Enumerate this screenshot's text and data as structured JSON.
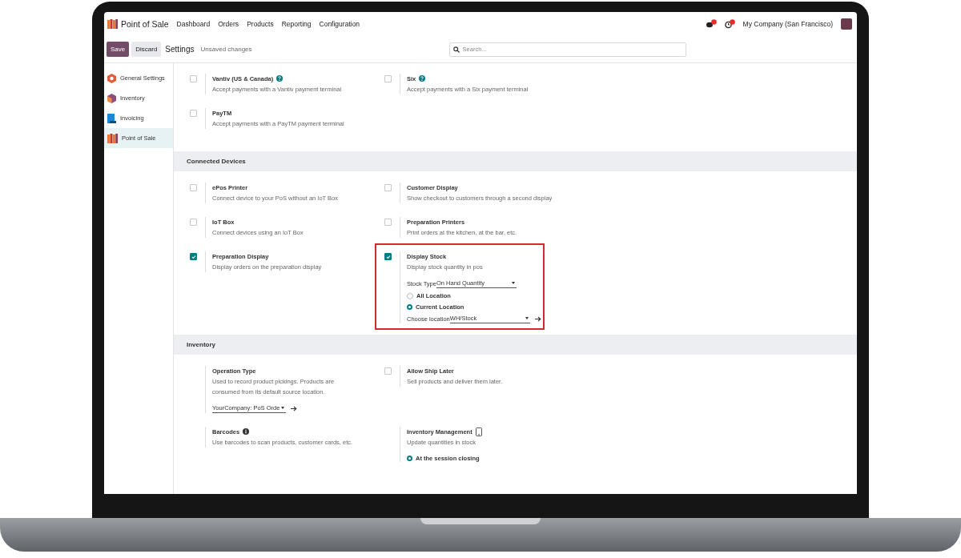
{
  "app": {
    "name": "Point of Sale"
  },
  "menu": [
    "Dashboard",
    "Orders",
    "Products",
    "Reporting",
    "Configuration"
  ],
  "company": "My Company (San Francisco)",
  "control_panel": {
    "save": "Save",
    "discard": "Discard",
    "title": "Settings",
    "status": "Unsaved changes",
    "search_placeholder": "Search..."
  },
  "sidebar": [
    {
      "label": "General Settings",
      "selected": false
    },
    {
      "label": "Inventory",
      "selected": false
    },
    {
      "label": "Invoicing",
      "selected": false
    },
    {
      "label": "Point of Sale",
      "selected": true
    }
  ],
  "sections": [
    {
      "settings": [
        {
          "kind": "checkbox",
          "checked": false,
          "title": "Vantiv (US & Canada)",
          "help_icon": true,
          "description": "Accept payments with a Vantiv payment terminal"
        },
        {
          "kind": "checkbox",
          "checked": false,
          "title": "Six",
          "help_icon": true,
          "description": "Accept payments with a Six payment terminal"
        },
        {
          "kind": "checkbox",
          "checked": false,
          "title": "PayTM",
          "description": "Accept payments with a PayTM payment terminal"
        }
      ]
    },
    {
      "title": "Connected Devices",
      "settings": [
        {
          "kind": "checkbox",
          "checked": false,
          "title": "ePos Printer",
          "description": "Connect device to your PoS without an IoT Box"
        },
        {
          "kind": "checkbox",
          "checked": false,
          "title": "Customer Display",
          "description": "Show checkout to customers through a second display"
        },
        {
          "kind": "checkbox",
          "checked": false,
          "title": "IoT Box",
          "description": "Connect devices using an IoT Box"
        },
        {
          "kind": "checkbox",
          "checked": false,
          "title": "Preparation Printers",
          "description": "Print orders at the kitchen, at the bar, etc."
        },
        {
          "kind": "checkbox",
          "checked": true,
          "title": "Preparation Display",
          "description": "Display orders on the preparation display"
        },
        {
          "kind": "checkbox",
          "checked": true,
          "title": "Display Stock",
          "description": "Display stock quantity in pos",
          "highlighted": true,
          "fields": [
            {
              "kind": "select",
              "label": "Stock Type",
              "value": "On Hand Quantity",
              "link": false
            },
            {
              "kind": "radio",
              "label": "All Location",
              "selected": false
            },
            {
              "kind": "radio",
              "label": "Current Location",
              "selected": true
            },
            {
              "kind": "select",
              "label": "Choose location",
              "value": "WH/Stock",
              "link": true
            }
          ]
        }
      ]
    },
    {
      "title": "Inventory",
      "settings": [
        {
          "kind": "plain",
          "title": "Operation Type",
          "description": "Used to record product pickings. Products are consumed from its default source location.",
          "fields": [
            {
              "kind": "select",
              "value": "YourCompany: PoS Orde",
              "link": true
            }
          ]
        },
        {
          "kind": "checkbox",
          "checked": false,
          "title": "Allow Ship Later",
          "description": "Sell products and deliver them later."
        },
        {
          "kind": "plain",
          "title": "Barcodes",
          "info_icon": true,
          "description": "Use barcodes to scan products, customer cards, etc."
        },
        {
          "kind": "plain",
          "title": "Inventory Management",
          "device_icon": true,
          "description": "Update quantities in stock",
          "fields": [
            {
              "kind": "radio",
              "label": "At the session closing",
              "selected": true
            }
          ]
        }
      ]
    }
  ]
}
